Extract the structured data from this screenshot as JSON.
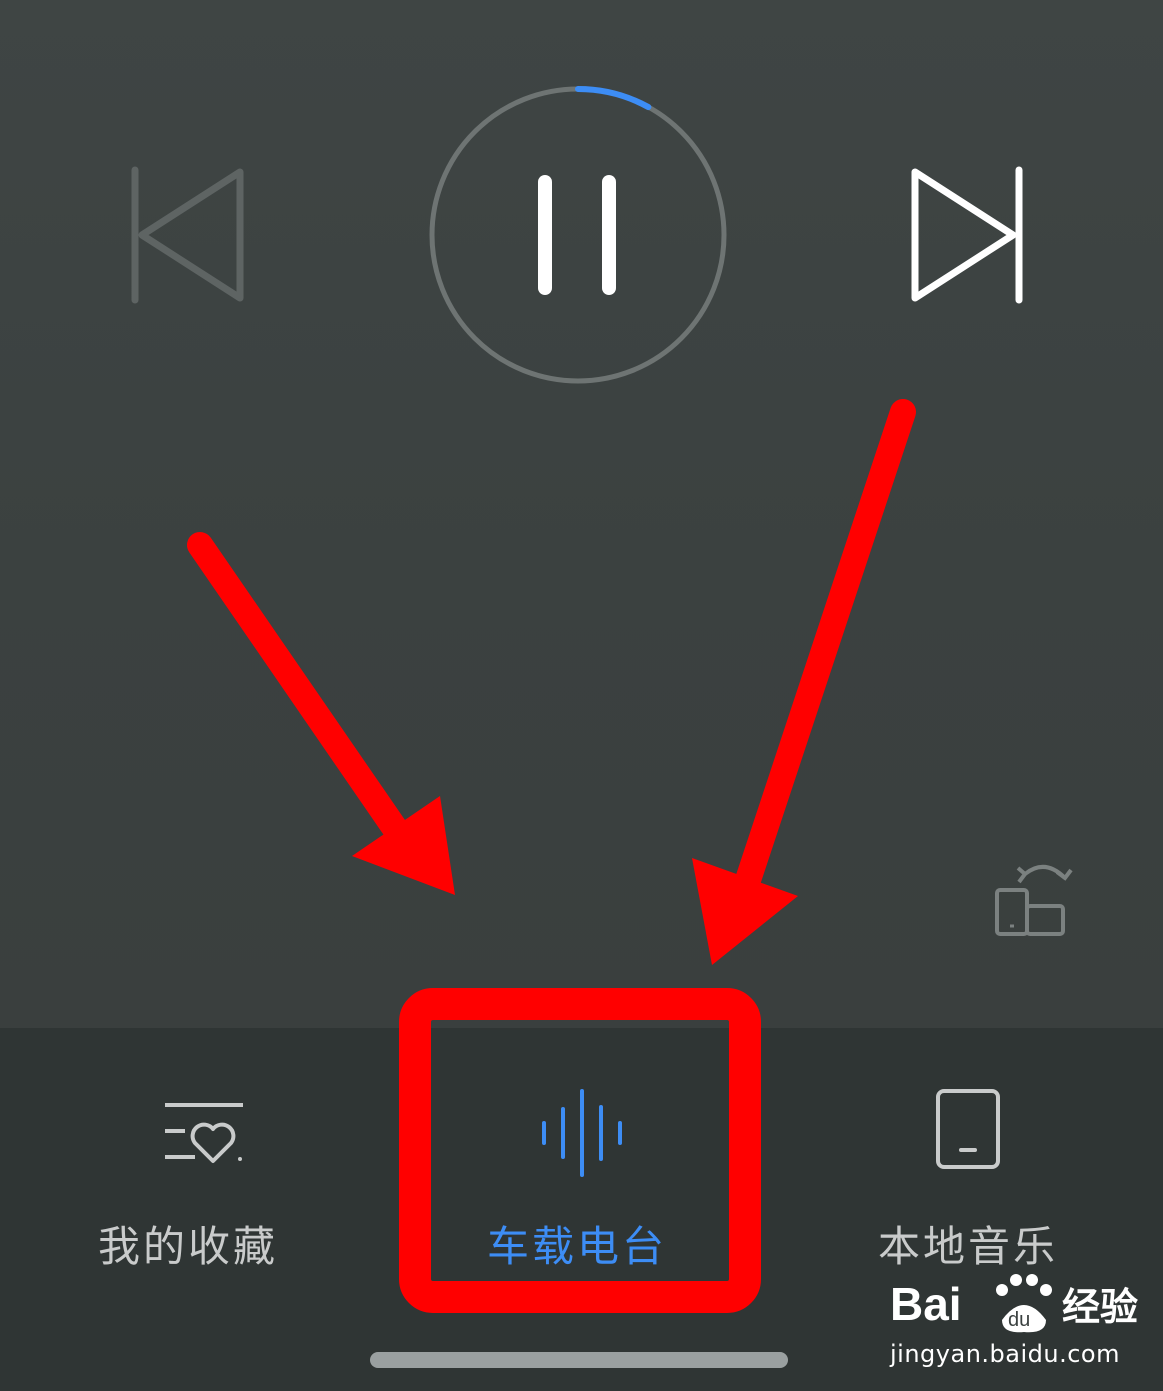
{
  "player": {
    "progress_fraction": 0.08,
    "accent_color": "#3d8df5",
    "controls": {
      "prev_icon": "skip-previous-icon",
      "play_pause_icon": "pause-icon",
      "next_icon": "skip-next-icon",
      "switch_device_icon": "switch-device-icon"
    }
  },
  "bottom_nav": {
    "items": [
      {
        "label": "我的收藏",
        "icon": "favorites-list-icon",
        "active": false
      },
      {
        "label": "车载电台",
        "icon": "sound-wave-icon",
        "active": true
      },
      {
        "label": "本地音乐",
        "icon": "phone-device-icon",
        "active": false
      }
    ]
  },
  "annotation": {
    "color": "#ff0000"
  },
  "watermark": {
    "brand": "Baidu经验",
    "domain": "jingyan.baidu.com"
  }
}
